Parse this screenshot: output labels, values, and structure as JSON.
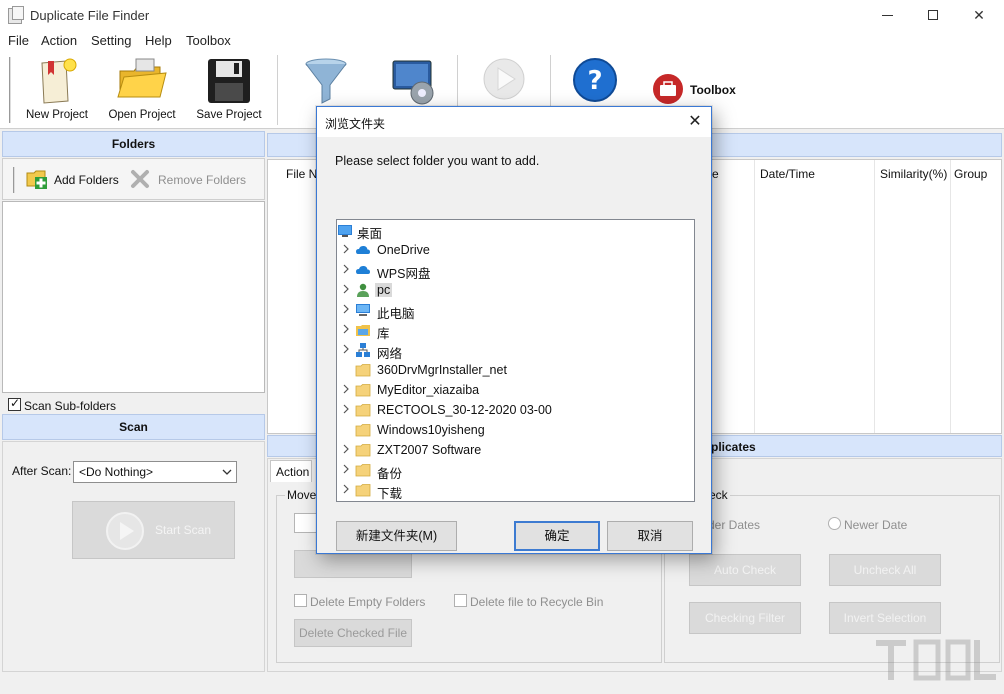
{
  "window": {
    "title": "Duplicate File Finder"
  },
  "menu": [
    "File",
    "Action",
    "Setting",
    "Help",
    "Toolbox"
  ],
  "toolbar": {
    "new_project": "New Project",
    "open_project": "Open Project",
    "save_project": "Save Project",
    "toolbox": "Toolbox"
  },
  "folders": {
    "header": "Folders",
    "add_label": "Add Folders",
    "remove_label": "Remove Folders",
    "scan_subfolders": "Scan Sub-folders"
  },
  "scan": {
    "header": "Scan",
    "after_scan_label": "After Scan:",
    "after_scan_value": "<Do Nothing>",
    "start_label": "Start Scan"
  },
  "grid": {
    "columns": [
      "File Na",
      "e",
      "Date/Time",
      "Similarity(%)",
      "Group"
    ]
  },
  "bottom": {
    "action_tab": "Action",
    "move_label": "Move",
    "delete_empty": "Delete Empty Folders",
    "recycle": "Delete file to Recycle Bin",
    "delete_checked": "Delete Checked File",
    "duplicates_header": "plicates",
    "check_group": "eck",
    "older_dates": "der Dates",
    "newer_date": "Newer Date",
    "auto_check": "Auto Check",
    "uncheck_all": "Uncheck All",
    "checking_filter": "Checking Filter",
    "invert_selection": "Invert Selection"
  },
  "dialog": {
    "title": "浏览文件夹",
    "prompt": "Please select folder you want to add.",
    "tree": [
      {
        "label": "桌面",
        "icon": "desktop-icon",
        "expander": false
      },
      {
        "label": "OneDrive",
        "icon": "cloud-icon",
        "expander": true
      },
      {
        "label": "WPS网盘",
        "icon": "cloud-icon",
        "expander": true
      },
      {
        "label": "pc",
        "icon": "user-icon",
        "expander": true,
        "selected": true
      },
      {
        "label": "此电脑",
        "icon": "computer-icon",
        "expander": true
      },
      {
        "label": "库",
        "icon": "library-icon",
        "expander": true
      },
      {
        "label": "网络",
        "icon": "network-icon",
        "expander": true
      },
      {
        "label": "360DrvMgrInstaller_net",
        "icon": "folder-icon",
        "expander": false
      },
      {
        "label": "MyEditor_xiazaiba",
        "icon": "folder-icon",
        "expander": true
      },
      {
        "label": "RECTOOLS_30-12-2020 03-00",
        "icon": "folder-icon",
        "expander": true
      },
      {
        "label": "Windows10yisheng",
        "icon": "folder-icon",
        "expander": false
      },
      {
        "label": "ZXT2007 Software",
        "icon": "folder-icon",
        "expander": true
      },
      {
        "label": "备份",
        "icon": "folder-icon",
        "expander": true
      },
      {
        "label": "下载",
        "icon": "folder-icon",
        "expander": true
      }
    ],
    "new_folder": "新建文件夹(M)",
    "ok": "确定",
    "cancel": "取消"
  }
}
